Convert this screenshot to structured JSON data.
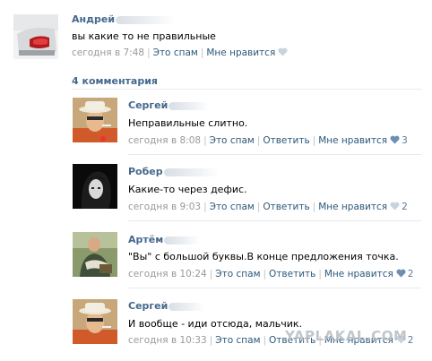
{
  "post": {
    "author": "Андрей",
    "text": "вы какие то не правильные",
    "time": "сегодня в 7:48",
    "spam": "Это спам",
    "like": "Мне нравится"
  },
  "comments_header": "4 комментария",
  "comments": [
    {
      "author": "Сергей",
      "text": "Неправильные слитно.",
      "time": "сегодня в 8:08",
      "spam": "Это спам",
      "reply": "Ответить",
      "like": "Мне нравится",
      "likes": "3"
    },
    {
      "author": "Робер",
      "text": "Какие-то через дефис.",
      "time": "сегодня в 9:03",
      "spam": "Это спам",
      "reply": "Ответить",
      "like": "Мне нравится",
      "likes": "2"
    },
    {
      "author": "Артём",
      "text": "\"Вы\" с большой буквы.В конце предложения точка.",
      "time": "сегодня в 10:24",
      "spam": "Это спам",
      "reply": "Ответить",
      "like": "Мне нравится",
      "likes": "2"
    },
    {
      "author": "Сергей",
      "text": "И вообще - иди отсюда, мальчик.",
      "time": "сегодня в 10:33",
      "spam": "Это спам",
      "reply": "Ответить",
      "like": "Мне нравится",
      "likes": "2"
    }
  ],
  "watermark": "YAPLAKAL.COM",
  "colors": {
    "link": "#2b587a",
    "name": "#45688e",
    "heart_active": "#6d8fb3",
    "heart_inactive": "#c9d3de"
  }
}
